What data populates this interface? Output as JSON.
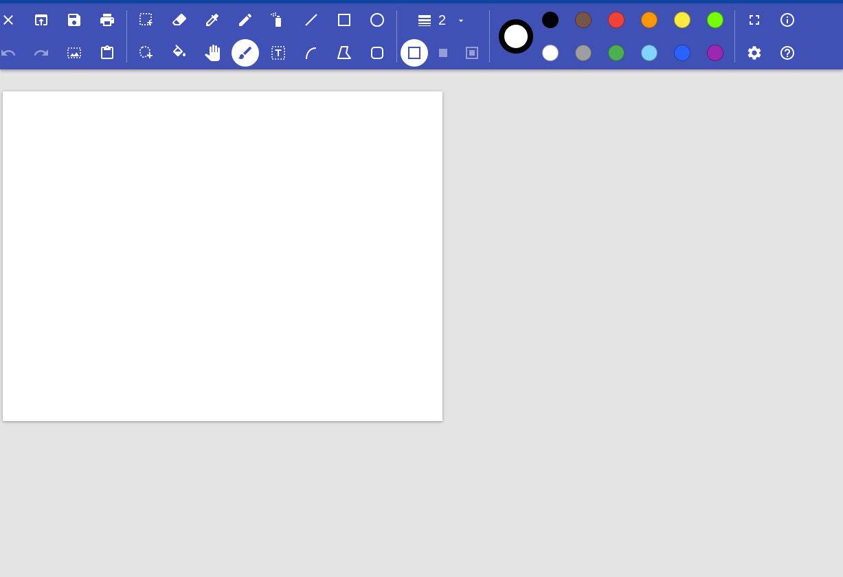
{
  "toolbar": {
    "line_width": "2",
    "current_color": "#ffffff",
    "palette": [
      {
        "name": "black",
        "color": "#000000"
      },
      {
        "name": "brown",
        "color": "#795548"
      },
      {
        "name": "red",
        "color": "#f44336"
      },
      {
        "name": "orange",
        "color": "#ff9800"
      },
      {
        "name": "yellow",
        "color": "#ffeb3b"
      },
      {
        "name": "lime",
        "color": "#76ff03"
      },
      {
        "name": "white",
        "color": "#ffffff"
      },
      {
        "name": "grey",
        "color": "#9e9e9e"
      },
      {
        "name": "green",
        "color": "#4caf50"
      },
      {
        "name": "light-blue",
        "color": "#81d4fa"
      },
      {
        "name": "blue",
        "color": "#2962ff"
      },
      {
        "name": "purple",
        "color": "#9c27b0"
      }
    ],
    "active_tool": "brush-icon",
    "active_fill_mode": "outline-only-icon"
  },
  "colors": {
    "toolbar_bg": "#3f51b5",
    "top_strip": "#0d47a1",
    "workspace_bg": "#e4e4e4",
    "canvas_bg": "#ffffff"
  }
}
